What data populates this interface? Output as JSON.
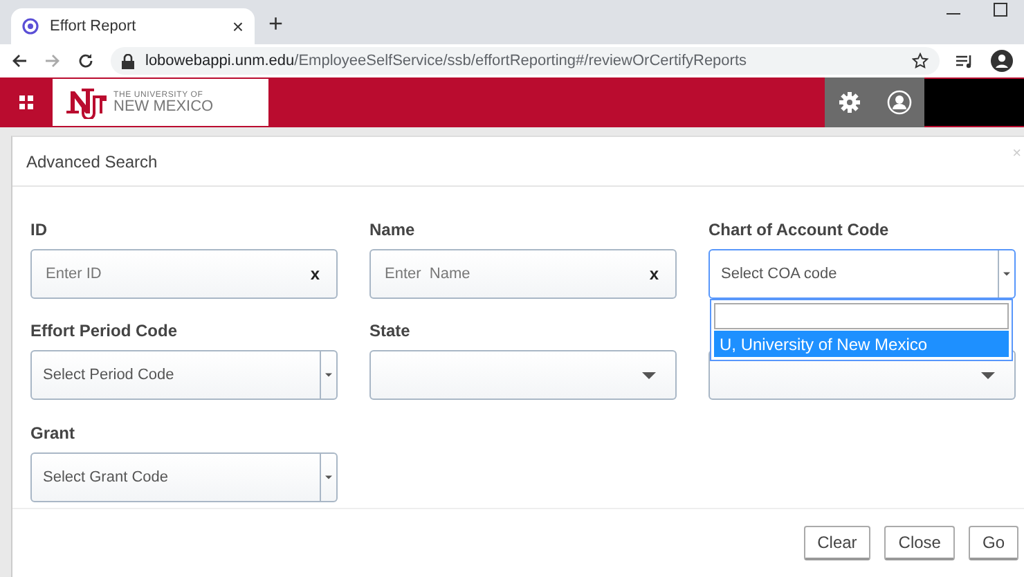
{
  "browser": {
    "tab": {
      "title": "Effort Report",
      "close": "×"
    },
    "new_tab": "+",
    "url_host": "lobowebappi.unm.edu",
    "url_path": "/EmployeeSelfService/ssb/effortReporting#/reviewOrCertifyReports"
  },
  "header": {
    "logo_line1": "THE UNIVERSITY OF",
    "logo_line2": "NEW MEXICO"
  },
  "dialog": {
    "title": "Advanced Search",
    "close": "×",
    "fields": [
      {
        "label": "ID",
        "kind": "text",
        "placeholder": "Enter ID",
        "clear": "x"
      },
      {
        "label": "Name",
        "kind": "text",
        "placeholder": "Enter  Name",
        "clear": "x"
      },
      {
        "label": "Chart of Account Code",
        "kind": "select",
        "placeholder": "Select COA code",
        "expanded": true,
        "options": [
          {
            "label": "U, University of New Mexico",
            "selected": true
          }
        ]
      },
      {
        "label": "Effort Period Code",
        "kind": "select",
        "placeholder": "Select Period Code",
        "expanded": false
      },
      {
        "label": "State",
        "kind": "dropdown"
      },
      {
        "kind": "dropdown"
      },
      {
        "label": "Grant",
        "kind": "select",
        "placeholder": "Select Grant Code",
        "expanded": false
      }
    ],
    "buttons": [
      "Clear",
      "Close",
      "Go"
    ]
  }
}
